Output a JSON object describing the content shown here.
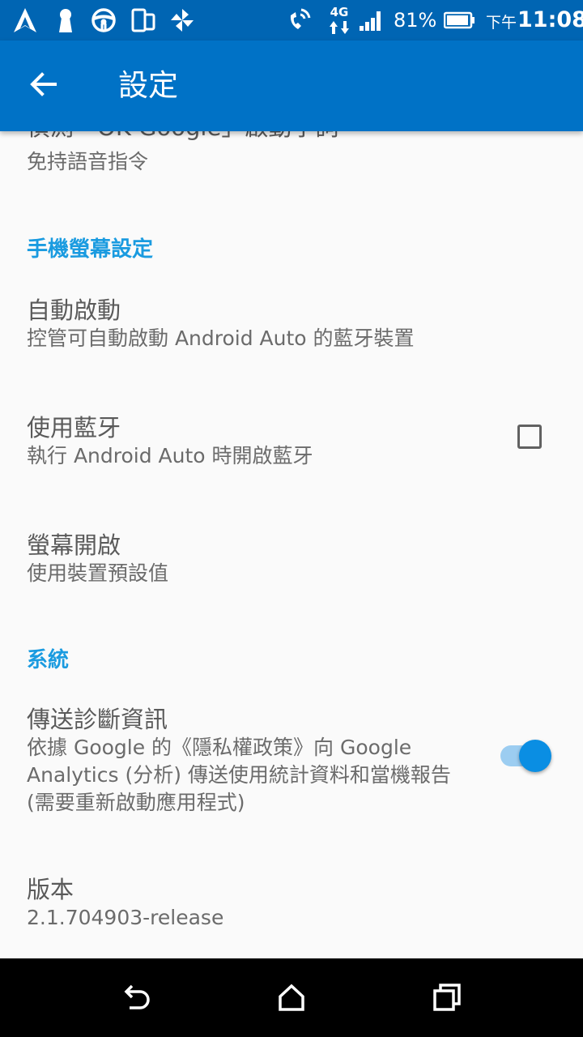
{
  "status_bar": {
    "network": "4G",
    "battery": "81%",
    "ampm": "下午",
    "time": "11:08",
    "icons": [
      "android-auto-icon",
      "keyhole-icon",
      "steering-wheel-icon",
      "phone-tablet-icon",
      "pinwheel-icon",
      "wifi-calling-icon",
      "signal-icon",
      "battery-icon"
    ]
  },
  "app_bar": {
    "title": "設定",
    "back_icon": "arrow-back-icon"
  },
  "settings": {
    "ok_google": {
      "title": "偵測「OK Google」啟動字詞",
      "summary": "免持語音指令"
    },
    "section_screen": "手機螢幕設定",
    "auto_launch": {
      "title": "自動啟動",
      "summary": "控管可自動啟動 Android Auto 的藍牙裝置"
    },
    "use_bluetooth": {
      "title": "使用藍牙",
      "summary": "執行 Android Auto 時開啟藍牙",
      "checked": false
    },
    "screen_on": {
      "title": "螢幕開啟",
      "summary": "使用裝置預設值"
    },
    "section_system": "系統",
    "send_diagnostics": {
      "title": "傳送診斷資訊",
      "summary": "依據 Google 的《隱私權政策》向 Google Analytics (分析) 傳送使用統計資料和當機報告 (需要重新啟動應用程式)",
      "enabled": true
    },
    "version": {
      "title": "版本",
      "summary": "2.1.704903-release"
    }
  },
  "nav_bar": {
    "icons": [
      "back-icon",
      "home-icon",
      "recents-icon"
    ]
  },
  "colors": {
    "status_bar": "#0065b3",
    "app_bar": "#0072c6",
    "accent": "#1a9be0",
    "background": "#fafafa"
  }
}
